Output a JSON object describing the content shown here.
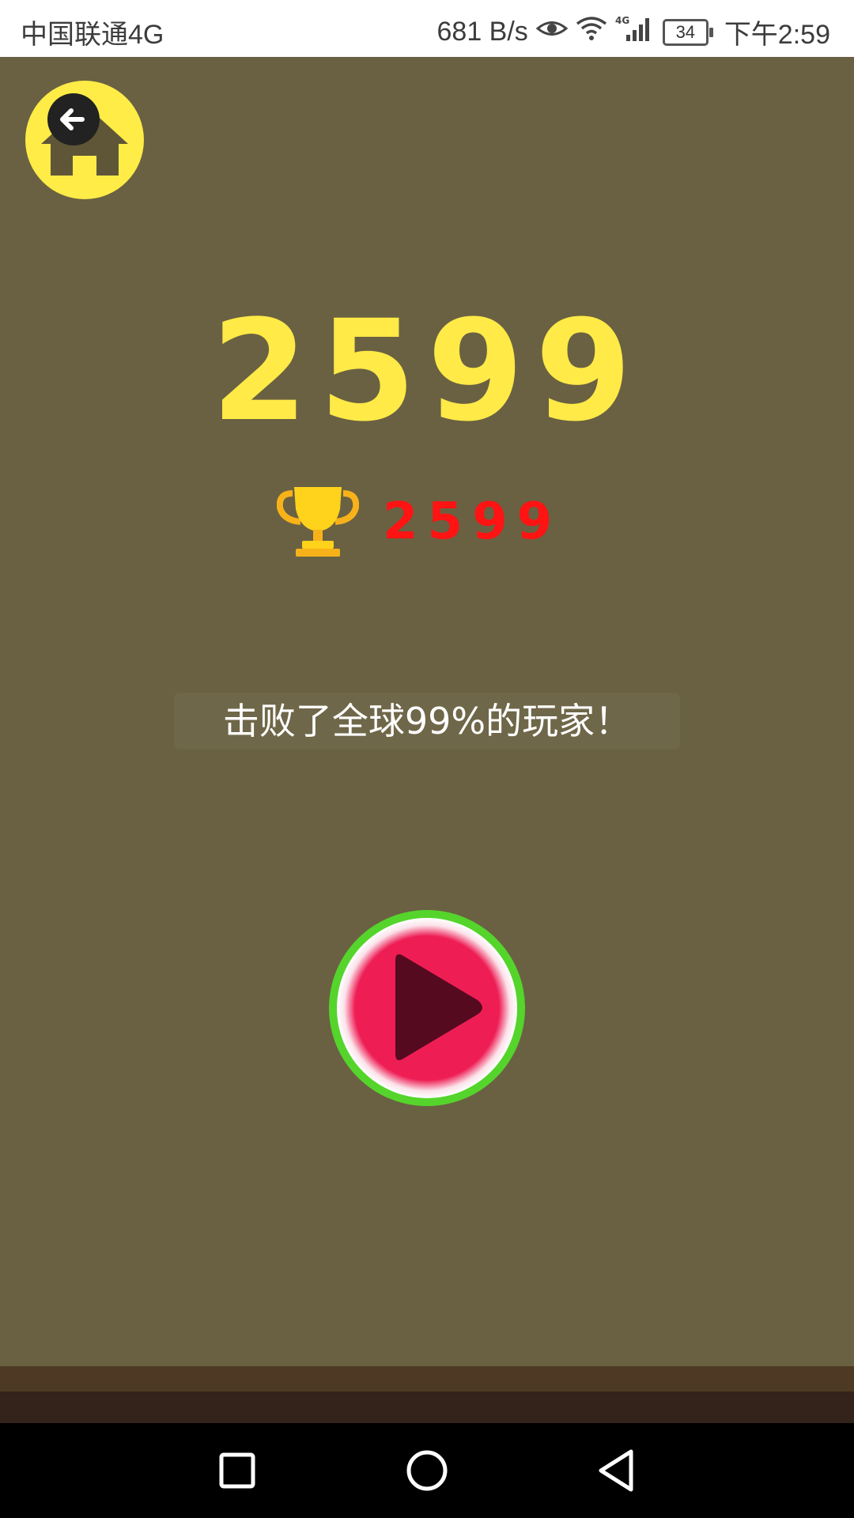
{
  "status_bar": {
    "carrier": "中国联通4G",
    "net_speed": "681 B/s",
    "battery": "34",
    "time": "下午2:59",
    "icons": [
      "eye-icon",
      "wifi-icon",
      "signal-4g-icon",
      "battery-icon"
    ]
  },
  "game": {
    "score": "2599",
    "best_score": "2599",
    "beat_message": "击败了全球99%的玩家！",
    "colors": {
      "background": "#6a6142",
      "score": "#ffea47",
      "best_score": "#ff1313",
      "play_ring": "#55d42c",
      "play_fill": "#ee1e55",
      "play_arrow": "#560a1f"
    },
    "icons": [
      "home-icon",
      "back-arrow-icon",
      "trophy-icon",
      "play-icon"
    ]
  },
  "nav_bar": {
    "icons": [
      "recent-apps-icon",
      "home-circle-icon",
      "back-triangle-icon"
    ]
  }
}
